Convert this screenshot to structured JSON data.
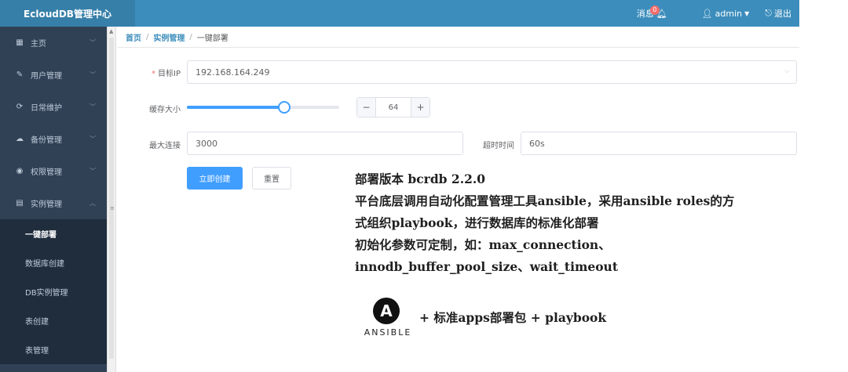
{
  "app": {
    "title": "EcloudDB管理中心",
    "messages_label": "消息",
    "messages_count": "0",
    "user": "admin",
    "logout": "退出"
  },
  "sidebar": {
    "items": [
      {
        "label": "主页",
        "icon": "grid-icon",
        "glyph": "▦",
        "chevron": "﹀"
      },
      {
        "label": "用户管理",
        "icon": "edit-icon",
        "glyph": "✎",
        "chevron": "﹀"
      },
      {
        "label": "日常维护",
        "icon": "refresh-icon",
        "glyph": "⟳",
        "chevron": "﹀"
      },
      {
        "label": "备份管理",
        "icon": "cloud-upload-icon",
        "glyph": "☁",
        "chevron": "﹀"
      },
      {
        "label": "权限管理",
        "icon": "eye-icon",
        "glyph": "◉",
        "chevron": "﹀"
      },
      {
        "label": "实例管理",
        "icon": "document-icon",
        "glyph": "▤",
        "chevron": "︿"
      }
    ],
    "sub_items": [
      {
        "label": "一键部署",
        "active": true
      },
      {
        "label": "数据库创建"
      },
      {
        "label": "DB实例管理"
      },
      {
        "label": "表创建"
      },
      {
        "label": "表管理"
      }
    ]
  },
  "breadcrumb": {
    "home": "首页",
    "section": "实例管理",
    "current": "一键部署",
    "separator": "/"
  },
  "form": {
    "target_ip_label": "目标IP",
    "target_ip_value": "192.168.164.249",
    "cache_label": "缓存大小",
    "cache_slider_fraction": 0.64,
    "cache_stepper_value": "64",
    "max_conn_label": "最大连接",
    "max_conn_value": "3000",
    "timeout_label": "超时时间",
    "timeout_value": "60s",
    "create_button": "立即创建",
    "reset_button": "重置"
  },
  "annotation": {
    "line1": "部署版本 bcrdb 2.2.0",
    "line2": "平台底层调用自动化配置管理工具ansible，采用ansible roles的方",
    "line3": "式组织playbook，进行数据库的标准化部署",
    "line4": "初始化参数可定制，如：max_connection、",
    "line5": "innodb_buffer_pool_size、wait_timeout",
    "logo_letter": "A",
    "logo_word": "ANSIBLE",
    "footer": "+ 标准apps部署包 + playbook"
  },
  "colors": {
    "topbar": "#3c8dbc",
    "sidebar": "#304156",
    "primary": "#409eff"
  }
}
